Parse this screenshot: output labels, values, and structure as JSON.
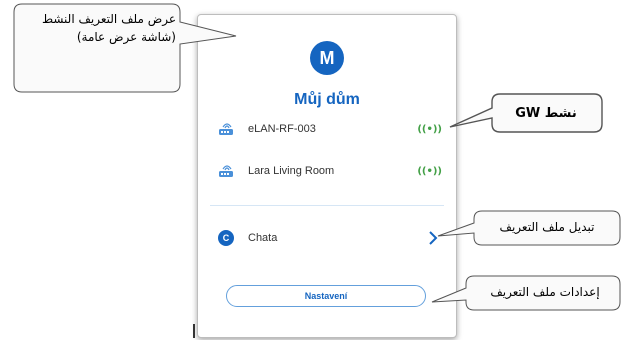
{
  "panel": {
    "avatar_letter": "M",
    "profile_name": "Můj dům",
    "gateways": [
      {
        "name": "eLAN-RF-003",
        "icon": "router-icon",
        "status_icon": "signal-active-icon",
        "status_glyph": "((•))"
      },
      {
        "name": "Lara Living Room",
        "icon": "router-icon",
        "status_icon": "signal-active-icon",
        "status_glyph": "((•))"
      }
    ],
    "other_profile": {
      "badge_letter": "C",
      "name": "Chata",
      "icon": "chevron-right-icon"
    },
    "settings_label": "Nastavení"
  },
  "callouts": {
    "active_profile": "عرض ملف التعريف النشط (شاشة عرض عامة)",
    "gw_active_latin": "GW",
    "gw_active_arabic": "نشط",
    "switch_profile": "تبديل ملف التعريف",
    "profile_settings": "إعدادات ملف التعريف"
  },
  "colors": {
    "accent": "#1565c0",
    "signal": "#43a047",
    "callout_fill": "#fafafa",
    "callout_stroke": "#555555"
  }
}
